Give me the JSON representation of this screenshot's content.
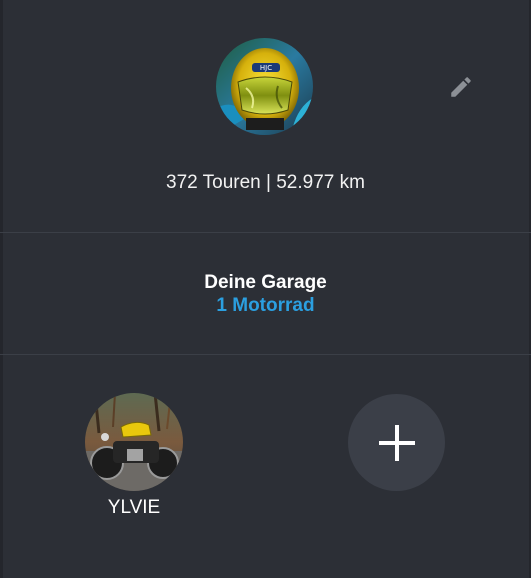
{
  "profile": {
    "avatar_icon": "helmet-avatar",
    "edit_icon": "pencil-icon",
    "stats": "372 Touren | 52.977 km"
  },
  "garage": {
    "title": "Deine Garage",
    "count": "1 Motorrad",
    "count_color": "#2b9fe0"
  },
  "bikes": [
    {
      "name": "YLVIE",
      "image": "motorcycle-photo"
    }
  ],
  "add_button": {
    "icon": "plus-icon"
  }
}
